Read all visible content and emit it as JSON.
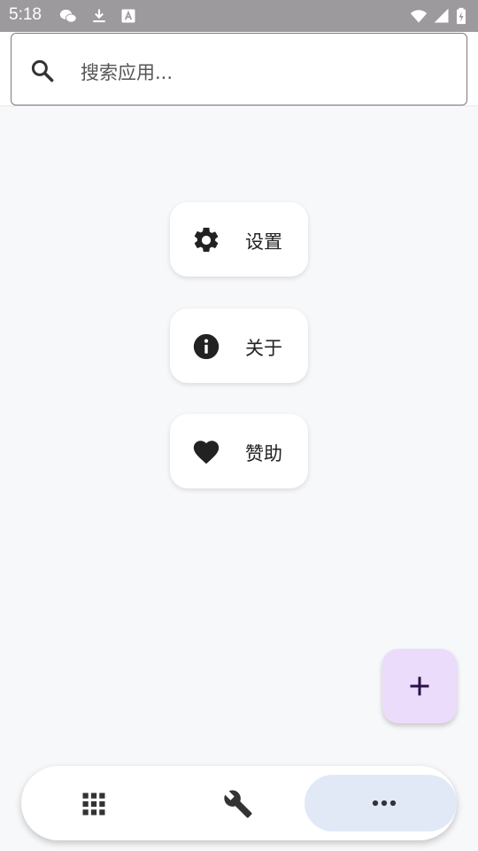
{
  "status_bar": {
    "time": "5:18",
    "icons": [
      "wechat-icon",
      "download-icon",
      "text-a-icon",
      "wifi-icon",
      "signal-icon",
      "battery-icon"
    ]
  },
  "search": {
    "placeholder": "搜索应用..."
  },
  "menu": {
    "items": [
      {
        "label": "设置",
        "icon": "gear-icon"
      },
      {
        "label": "关于",
        "icon": "info-icon"
      },
      {
        "label": "赞助",
        "icon": "heart-icon"
      }
    ]
  },
  "fab": {
    "icon": "plus-icon",
    "color": "#ecdcfb"
  },
  "bottom_nav": {
    "items": [
      {
        "icon": "grid-icon"
      },
      {
        "icon": "wrench-icon"
      },
      {
        "icon": "more-icon",
        "active": true
      }
    ],
    "active_color": "#e1e9f7"
  }
}
